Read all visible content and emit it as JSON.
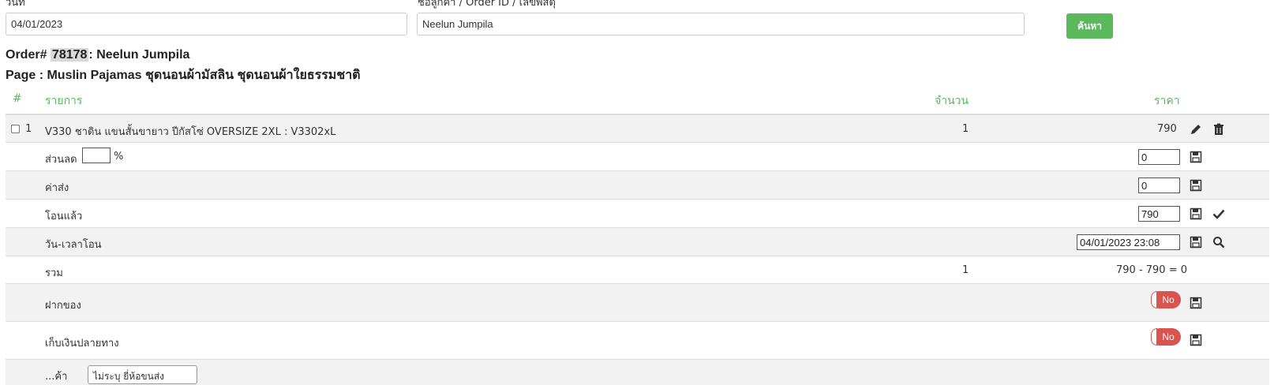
{
  "filter": {
    "date_label": "วันที่",
    "date_value": "04/01/2023",
    "search_label": "ชื่อลูกค้า / Order ID / เลขพัสดุ",
    "search_value": "Neelun Jumpila",
    "search_button": "ค้นหา"
  },
  "order": {
    "prefix": "Order#",
    "id": "78178",
    "customer": ": Neelun Jumpila",
    "page": "Page : Muslin Pajamas ชุดนอนผ้ามัสลิน ชุดนอนผ้าใยธรรมชาติ"
  },
  "table": {
    "headers": {
      "num": "#",
      "item": "รายการ",
      "qty": "จำนวน",
      "price": "ราคา"
    },
    "item": {
      "num": "1",
      "name": "V330 ชาดิน แขนสั้นขายาว ปีกัสโซ่ OVERSIZE 2XL : V3302xL",
      "qty": "1",
      "price": "790"
    },
    "discount": {
      "label": "ส่วนลด",
      "percent_value": "",
      "percent_sign": "%",
      "value": "0"
    },
    "shipping": {
      "label": "ค่าส่ง",
      "value": "0"
    },
    "paid": {
      "label": "โอนแล้ว",
      "value": "790"
    },
    "transfer_time": {
      "label": "วัน-เวลาโอน",
      "value": "04/01/2023 23:08"
    },
    "total": {
      "label": "รวม",
      "qty": "1",
      "calc": "790 - 790 = 0"
    },
    "deposit": {
      "label": "ฝากของ",
      "toggle": "No"
    },
    "cod": {
      "label": "เก็บเงินปลายทาง",
      "toggle": "No"
    },
    "next_row": {
      "label": "...ค้า",
      "select": "ไม่ระบุ ยี่ห้อขนส่ง"
    }
  },
  "icons": {
    "edit": "pencil-icon",
    "delete": "trash-icon",
    "save": "floppy-disk-icon",
    "confirm": "check-icon",
    "search": "magnifier-icon"
  },
  "colors": {
    "accent": "#5cb85c",
    "toggle_off": "#d9534f",
    "row_alt": "#f2f2f2"
  }
}
